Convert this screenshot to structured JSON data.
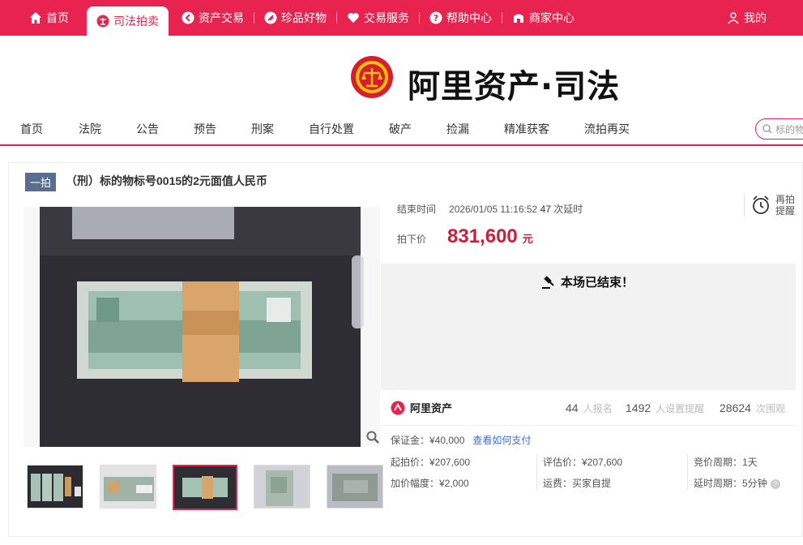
{
  "top_nav": {
    "items": [
      {
        "label": "首页",
        "icon": "home-icon"
      },
      {
        "label": "司法拍卖",
        "icon": "court-icon"
      },
      {
        "label": "资产交易",
        "icon": "asset-icon"
      },
      {
        "label": "珍品好物",
        "icon": "tag-icon"
      },
      {
        "label": "交易服务",
        "icon": "heart-icon"
      },
      {
        "label": "帮助中心",
        "icon": "help-icon"
      },
      {
        "label": "商家中心",
        "icon": "shop-icon"
      }
    ],
    "my_label": "我的"
  },
  "brand": {
    "title": "阿里资产·司法"
  },
  "main_nav": {
    "items": [
      "首页",
      "法院",
      "公告",
      "预告",
      "刑案",
      "自行处置",
      "破产",
      "捡漏",
      "精准获客",
      "流拍再买"
    ],
    "search_placeholder": "标的物"
  },
  "lot": {
    "badge": "一拍",
    "title": "（刑）标的物标号0015的2元面值人民币"
  },
  "info": {
    "end_time_label": "结束时间",
    "end_time": "2026/01/05 11:16:52",
    "delay_count": "47",
    "delay_label": "次延时",
    "remind_label_1": "再拍",
    "remind_label_2": "提醒",
    "price_label": "拍下价",
    "price": "831,600",
    "price_unit": "元",
    "ended_text": "本场已结束！",
    "ali_label": "阿里资产",
    "stats": [
      {
        "value": "44",
        "label": "人报名"
      },
      {
        "value": "1492",
        "label": "人设置提醒"
      },
      {
        "value": "28624",
        "label": "次围观"
      }
    ],
    "deposit": "保证金：¥40,000",
    "deposit_link": "查看如何支付",
    "start_price": "起拍价：¥207,600",
    "eval_price": "评估价：¥207,600",
    "bid_period": "竞价周期：1天",
    "increment": "加价幅度：¥2,000",
    "shipping": "运费：买家自提",
    "delay_period": "延时周期：5分钟"
  },
  "colors": {
    "accent": "#e8234f",
    "price": "#c8203a",
    "link": "#3a6fd8"
  }
}
